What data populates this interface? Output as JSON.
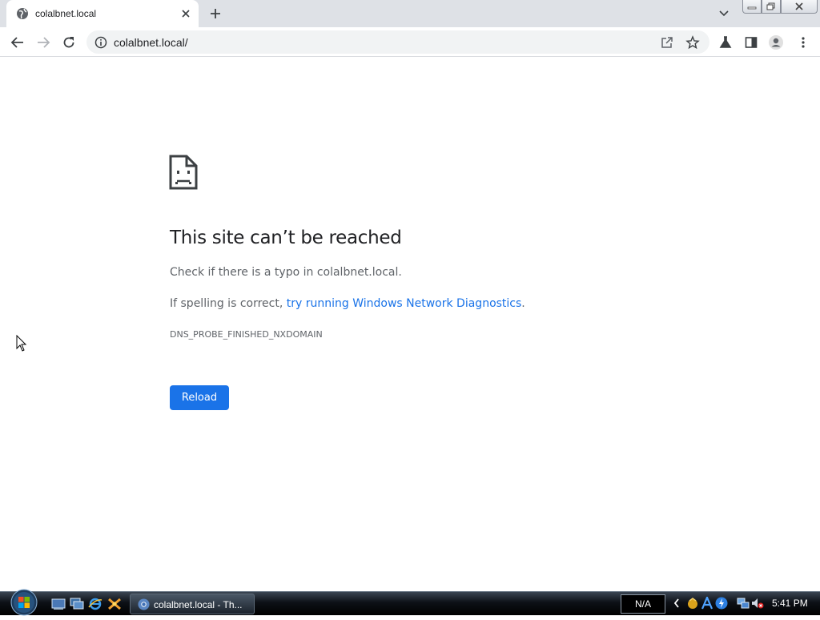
{
  "tab": {
    "title": "colalbnet.local"
  },
  "omnibox": {
    "url": "colalbnet.local/"
  },
  "error": {
    "title": "This site can’t be reached",
    "line1": "Check if there is a typo in colalbnet.local.",
    "line2_prefix": "If spelling is correct, ",
    "line2_link": "try running Windows Network Diagnostics",
    "line2_suffix": ".",
    "code": "DNS_PROBE_FINISHED_NXDOMAIN",
    "reload_label": "Reload"
  },
  "taskbar": {
    "window_label": "colalbnet.local - Th...",
    "language": "N/A",
    "clock": "5:41 PM"
  },
  "colors": {
    "accent": "#1a73e8",
    "text": "#202124",
    "muted": "#5f6368"
  }
}
